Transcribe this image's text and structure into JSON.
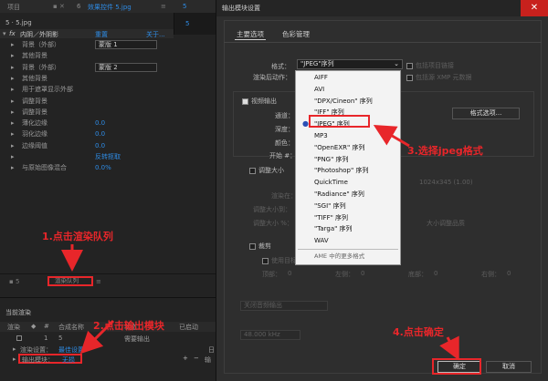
{
  "left": {
    "tab1": "项目",
    "tab2": "效果控件 5.jpg",
    "tab2_prefix": "6",
    "mini_tab": "5",
    "layer_name": "5 · 5.jpg",
    "fx_row": {
      "name": "内阴／外阴影",
      "reset": "重置",
      "about": "关于..."
    },
    "props": [
      {
        "label": "背景（外部）",
        "value": "蒙版 1"
      },
      {
        "label": "其他背景",
        "value": ""
      },
      {
        "label": "背景（外部）",
        "value": "蒙版 2"
      },
      {
        "label": "其他背景",
        "value": ""
      },
      {
        "label": "用于遮罩显示外部",
        "value": ""
      },
      {
        "label": "调整背景",
        "value": ""
      },
      {
        "label": "调整背景",
        "value": ""
      },
      {
        "label": "薄化边缘",
        "value": "0.0"
      },
      {
        "label": "羽化边缘",
        "value": "0.0"
      },
      {
        "label": "边缘阈值",
        "value": "0.0"
      },
      {
        "label": "",
        "value": "反转抠取"
      },
      {
        "label": "与原始图像混合",
        "value": "0.0%"
      }
    ],
    "queue_item": "渲染队列",
    "current_render": "当前渲染",
    "cols": [
      "渲染",
      "#",
      "合成名称",
      "状态",
      "已启动"
    ],
    "render_row": {
      "num": "1",
      "name": "5",
      "status": "需要输出"
    },
    "render_settings": {
      "label": "渲染设置：",
      "value": "最佳设置"
    },
    "output_module": {
      "label": "输出模块：",
      "value": "无损"
    },
    "log_label": "日志：",
    "output_to": "输出到："
  },
  "dialog": {
    "title": "输出模块设置",
    "close": "✕",
    "tabs": [
      "主要选项",
      "色彩管理"
    ],
    "format_label": "格式：",
    "format_value": "\"JPEG\"序列",
    "post_render_label": "渲染后动作：",
    "include_project": "包括项目链接",
    "include_xmp": "包括源 XMP 元数据",
    "video_output": "视频输出",
    "channels_label": "通道：",
    "depth_label": "深度：",
    "color_label": "颜色：",
    "start_label": "开始 #：",
    "format_options": "格式选项...",
    "resize": "调整大小",
    "resize_dims": "1024x345 (1.00)",
    "resize_rows": [
      "渲染在：",
      "调整大小到：",
      "调整大小 %："
    ],
    "resize_quality": "大小调整品质",
    "crop": "裁剪",
    "use_roi": "使用目标区域",
    "crop_fields": [
      "顶部：",
      "左侧：",
      "底部：",
      "右侧："
    ],
    "crop_values": [
      "0",
      "0",
      "0",
      "0"
    ],
    "audio_auto": "关闭音频输出",
    "audio_rate": "48.000 kHz",
    "ok": "确定",
    "cancel": "取消"
  },
  "menu": {
    "items": [
      "AIFF",
      "AVI",
      "\"DPX/Cineon\" 序列",
      "\"IFF\" 序列",
      "\"JPEG\" 序列",
      "MP3",
      "\"OpenEXR\" 序列",
      "\"PNG\" 序列",
      "\"Photoshop\" 序列",
      "QuickTime",
      "\"Radiance\" 序列",
      "\"SGI\" 序列",
      "\"TIFF\" 序列",
      "\"Targa\" 序列",
      "WAV",
      "AME 中的更多格式"
    ],
    "selected_index": 4
  },
  "annotations": {
    "a1": "1.点击渲染队列",
    "a2": "2.点击输出模块",
    "a3": "3.选择jpeg格式",
    "a4": "4.点击确定"
  },
  "colors": {
    "accent_red": "#e8262a",
    "link_blue": "#2e8ce6",
    "close_red": "#c8211d"
  }
}
